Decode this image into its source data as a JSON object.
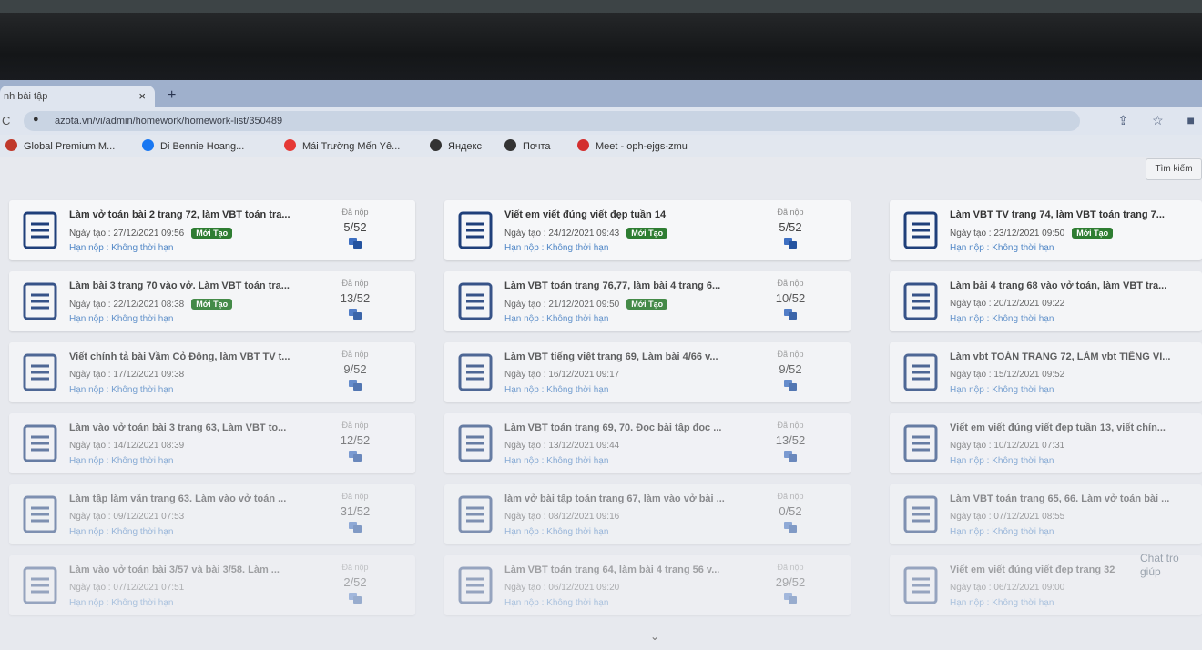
{
  "browser": {
    "tab_title": "nh bài tập",
    "tab_close": "×",
    "new_tab": "+",
    "reload": "C",
    "url": "azota.vn/vi/admin/homework/homework-list/350489",
    "bookmarks": [
      {
        "label": "Global Premium M...",
        "icon": "globe-icon",
        "color": "#c0392b"
      },
      {
        "label": "Di Bennie Hoang...",
        "icon": "facebook-icon",
        "color": "#1877f2"
      },
      {
        "label": "Mái Trường Mến Yê...",
        "icon": "youtube-icon",
        "color": "#e53935"
      },
      {
        "label": "Яндекс",
        "icon": "yandex-icon",
        "color": "#333333"
      },
      {
        "label": "Почта",
        "icon": "mail-icon",
        "color": "#333333"
      },
      {
        "label": "Meet - oph-ejgs-zmu",
        "icon": "meet-icon",
        "color": "#d32f2f"
      }
    ]
  },
  "toolbar": {
    "search_label": "Tìm kiếm"
  },
  "labels": {
    "submitted": "Đã nộp",
    "new_badge": "Mới Tạo",
    "created_prefix": "Ngày tạo : ",
    "deadline": "Hạn nộp : Không thời hạn"
  },
  "homework": [
    {
      "title": "Làm vở toán bài 2 trang 72, làm VBT toán tra...",
      "created": "27/12/2021 09:56",
      "is_new": true,
      "submitted": "5/52"
    },
    {
      "title": "Viết em viết đúng viết đẹp tuần 14",
      "created": "24/12/2021 09:43",
      "is_new": true,
      "submitted": "5/52"
    },
    {
      "title": "Làm VBT TV trang 74, làm VBT toán trang 7...",
      "created": "23/12/2021 09:50",
      "is_new": true,
      "submitted": ""
    },
    {
      "title": "Làm bài 3 trang 70 vào vở. Làm VBT toán tra...",
      "created": "22/12/2021 08:38",
      "is_new": true,
      "submitted": "13/52"
    },
    {
      "title": "Làm VBT toán trang 76,77, làm bài 4 trang 6...",
      "created": "21/12/2021 09:50",
      "is_new": true,
      "submitted": "10/52"
    },
    {
      "title": "Làm bài 4 trang 68 vào vở toán, làm VBT tra...",
      "created": "20/12/2021 09:22",
      "is_new": false,
      "submitted": ""
    },
    {
      "title": "Viết chính tả bài Vầm Cỏ Đông, làm VBT TV t...",
      "created": "17/12/2021 09:38",
      "is_new": false,
      "submitted": "9/52"
    },
    {
      "title": "Làm VBT tiếng việt trang 69, Làm bài 4/66 v...",
      "created": "16/12/2021 09:17",
      "is_new": false,
      "submitted": "9/52"
    },
    {
      "title": "Làm vbt TOÁN TRANG 72, LÀM vbt TIẾNG VI...",
      "created": "15/12/2021 09:52",
      "is_new": false,
      "submitted": ""
    },
    {
      "title": "Làm vào vở toán bài 3 trang 63, Làm VBT to...",
      "created": "14/12/2021 08:39",
      "is_new": false,
      "submitted": "12/52"
    },
    {
      "title": "Làm VBT toán trang 69, 70. Đọc bài tập đọc ...",
      "created": "13/12/2021 09:44",
      "is_new": false,
      "submitted": "13/52"
    },
    {
      "title": "Viết em viết đúng viết đẹp tuần 13, viết chín...",
      "created": "10/12/2021 07:31",
      "is_new": false,
      "submitted": ""
    },
    {
      "title": "Làm tập làm văn trang 63. Làm vào vở toán ...",
      "created": "09/12/2021 07:53",
      "is_new": false,
      "submitted": "31/52"
    },
    {
      "title": "làm vở bài tập toán trang 67, làm vào vở bài ...",
      "created": "08/12/2021 09:16",
      "is_new": false,
      "submitted": "0/52"
    },
    {
      "title": "Làm VBT toán trang 65, 66. Làm vở toán bài ...",
      "created": "07/12/2021 08:55",
      "is_new": false,
      "submitted": ""
    },
    {
      "title": "Làm vào vở toán bài 3/57 và bài 3/58. Làm ...",
      "created": "07/12/2021 07:51",
      "is_new": false,
      "submitted": "2/52"
    },
    {
      "title": "Làm VBT toán trang 64, làm bài 4 trang 56 v...",
      "created": "06/12/2021 09:20",
      "is_new": false,
      "submitted": "29/52"
    },
    {
      "title": "Viết em viết đúng viết đẹp trang 32",
      "created": "06/12/2021 09:00",
      "is_new": false,
      "submitted": ""
    }
  ],
  "footer": {
    "chat_hint": "Chat tro giúp",
    "scroll_icon": "chevron-down-icon"
  }
}
